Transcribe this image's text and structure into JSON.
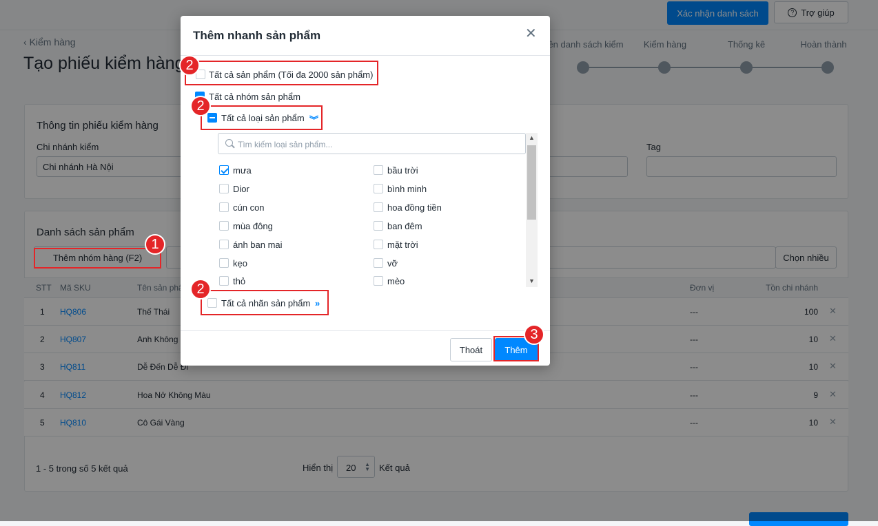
{
  "header": {
    "confirm_label": "Xác nhận danh sách",
    "help_label": "Trợ giúp"
  },
  "page": {
    "back_label": "Kiểm hàng",
    "title": "Tạo phiếu kiểm hàng"
  },
  "steps": [
    "ên danh sách kiểm",
    "Kiểm hàng",
    "Thống kê",
    "Hoàn thành"
  ],
  "info_card": {
    "title": "Thông tin phiếu kiểm hàng",
    "branch_label": "Chi nhánh kiểm",
    "branch_value": "Chi nhánh Hà Nội",
    "tag_label": "Tag"
  },
  "product_card": {
    "title": "Danh sách sản phẩm",
    "add_group_label": "Thêm nhóm hàng (F2)",
    "choose_many_label": "Chọn nhiều"
  },
  "table": {
    "headers": {
      "stt": "STT",
      "sku": "Mã SKU",
      "name": "Tên sản phẩ",
      "unit": "Đơn vị",
      "stock": "Tồn chi nhánh"
    },
    "rows": [
      {
        "stt": "1",
        "sku": "HQ806",
        "name": "Thế Thái",
        "unit": "---",
        "stock": "100"
      },
      {
        "stt": "2",
        "sku": "HQ807",
        "name": "Anh Không",
        "unit": "---",
        "stock": "10"
      },
      {
        "stt": "3",
        "sku": "HQ811",
        "name": "Dễ Đến Dễ Đi",
        "unit": "---",
        "stock": "10"
      },
      {
        "stt": "4",
        "sku": "HQ812",
        "name": "Hoa Nở Không Màu",
        "unit": "---",
        "stock": "9"
      },
      {
        "stt": "5",
        "sku": "HQ810",
        "name": "Cô Gái Vàng",
        "unit": "---",
        "stock": "10"
      }
    ]
  },
  "pagination": {
    "summary": "1 - 5 trong số 5 kết quả",
    "show_label": "Hiển thị",
    "page_size": "20",
    "results_label": "Kết quả"
  },
  "modal": {
    "title": "Thêm nhanh sản phẩm",
    "all_products": "Tất cả sản phẩm (Tối đa 2000 sản phẩm)",
    "all_groups": "Tất cả nhóm sản phẩm",
    "all_types": "Tất cả loại sản phẩm",
    "search_placeholder": "Tìm kiếm loại sản phẩm...",
    "options_left": [
      "mưa",
      "Dior",
      "cún con",
      "mùa đông",
      "ánh ban mai",
      "kẹo",
      "thỏ"
    ],
    "options_right": [
      "bầu trời",
      "bình minh",
      "hoa đồng tiền",
      "ban đêm",
      "mặt trời",
      "vỡ",
      "mèo"
    ],
    "all_tags": "Tất cả nhãn sản phẩm",
    "cancel_label": "Thoát",
    "add_label": "Thêm"
  },
  "badges": [
    "1",
    "2",
    "2",
    "2",
    "3"
  ],
  "colors": {
    "primary": "#0088ff",
    "annotation_red": "#e42528"
  }
}
